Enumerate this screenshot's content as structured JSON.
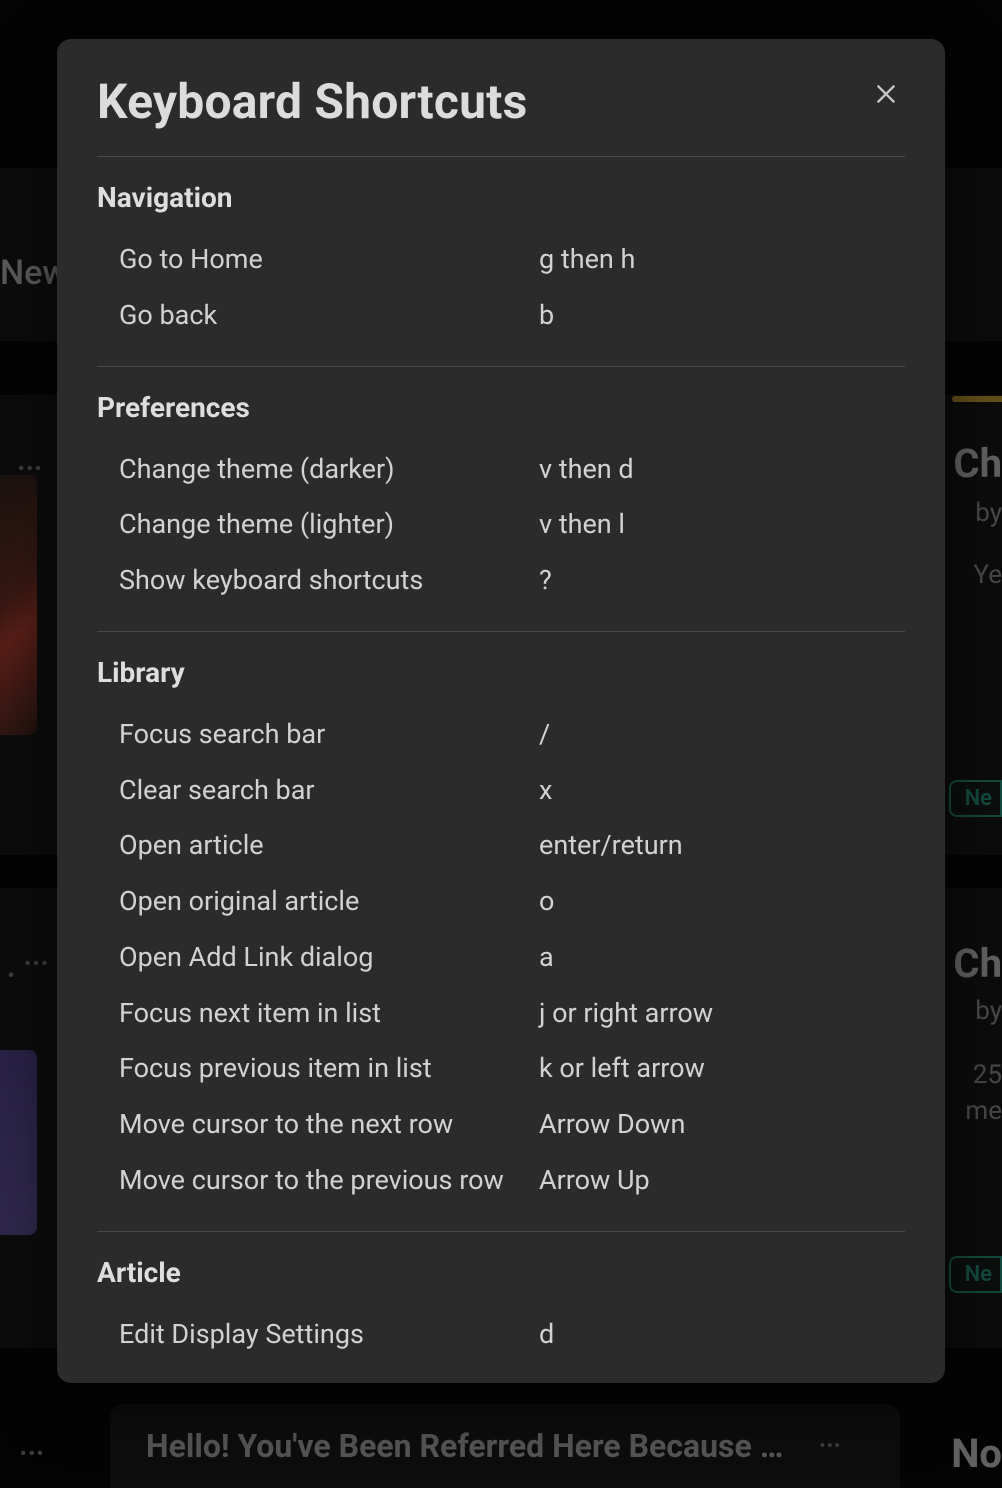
{
  "modal": {
    "title": "Keyboard Shortcuts",
    "sections": [
      {
        "title": "Navigation",
        "items": [
          {
            "action": "Go to Home",
            "keys": "g then h"
          },
          {
            "action": "Go back",
            "keys": "b"
          }
        ]
      },
      {
        "title": "Preferences",
        "items": [
          {
            "action": "Change theme (darker)",
            "keys": "v then d"
          },
          {
            "action": "Change theme (lighter)",
            "keys": "v then l"
          },
          {
            "action": "Show keyboard shortcuts",
            "keys": "?"
          }
        ]
      },
      {
        "title": "Library",
        "items": [
          {
            "action": "Focus search bar",
            "keys": "/"
          },
          {
            "action": "Clear search bar",
            "keys": "x"
          },
          {
            "action": "Open article",
            "keys": "enter/return"
          },
          {
            "action": "Open original article",
            "keys": "o"
          },
          {
            "action": "Open Add Link dialog",
            "keys": "a"
          },
          {
            "action": "Focus next item in list",
            "keys": "j or right arrow"
          },
          {
            "action": "Focus previous item in list",
            "keys": "k or left arrow"
          },
          {
            "action": "Move cursor to the next row",
            "keys": "Arrow Down"
          },
          {
            "action": "Move cursor to the previous row",
            "keys": "Arrow Up"
          }
        ]
      },
      {
        "title": "Article",
        "items": [
          {
            "action": "Edit Display Settings",
            "keys": "d"
          }
        ]
      }
    ]
  },
  "background": {
    "new_label": "New",
    "right1_title": "Ch",
    "right1_by": "by",
    "right1_date": "Ye",
    "badge1": "Ne",
    "right2_title": "Ch",
    "right2_by": "by",
    "right2_line1": "25",
    "right2_line2": "me",
    "badge2": "Ne",
    "right3_title": "No",
    "bottom_title": "Hello! You've Been Referred Here Because …"
  }
}
